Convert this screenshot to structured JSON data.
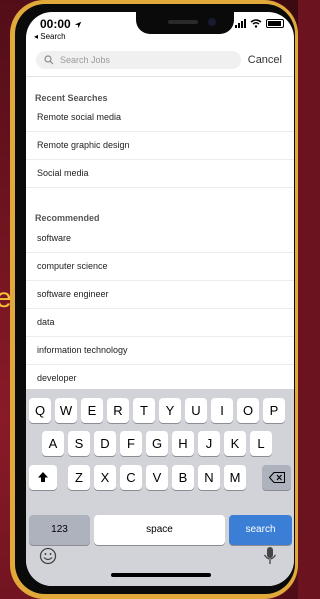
{
  "status": {
    "time": "00:00",
    "back": "◂ Search"
  },
  "search": {
    "placeholder": "Search Jobs",
    "cancel": "Cancel"
  },
  "recent": {
    "title": "Recent Searches",
    "items": [
      "Remote social media",
      "Remote graphic design",
      "Social media"
    ]
  },
  "recommended": {
    "title": "Recommended",
    "items": [
      "software",
      "computer science",
      "software engineer",
      "data",
      "information technology",
      "developer"
    ]
  },
  "keyboard": {
    "row1": [
      "Q",
      "W",
      "E",
      "R",
      "T",
      "Y",
      "U",
      "I",
      "O",
      "P"
    ],
    "row2": [
      "A",
      "S",
      "D",
      "F",
      "G",
      "H",
      "J",
      "K",
      "L"
    ],
    "row3": [
      "Z",
      "X",
      "C",
      "V",
      "B",
      "N",
      "M"
    ],
    "numbers_label": "123",
    "space_label": "space",
    "search_label": "search"
  },
  "background": {
    "side_letter": "e"
  },
  "colors": {
    "accent": "#3a7fd5",
    "frame": "#e0a93a",
    "background": "#6b1420"
  }
}
